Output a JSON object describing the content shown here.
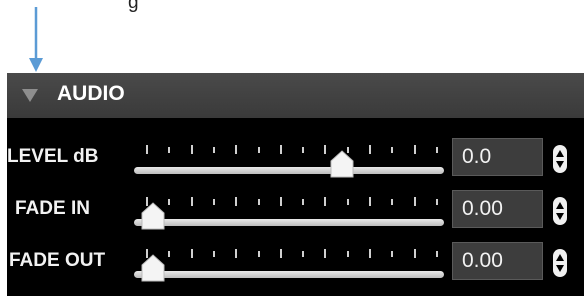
{
  "caption_fragment": "g",
  "panel": {
    "title": "AUDIO"
  },
  "rows": [
    {
      "label": "LEVEL dB",
      "value": "0.0",
      "slider_fraction": 0.68
    },
    {
      "label": "FADE IN",
      "value": "0.00",
      "slider_fraction": 0.0
    },
    {
      "label": "FADE OUT",
      "value": "0.00",
      "slider_fraction": 0.0
    }
  ],
  "icons": {
    "pointer": "down-arrow-icon",
    "collapse": "disclosure-triangle-icon",
    "stepper": "up-down-stepper-icon"
  },
  "colors": {
    "annotation_arrow": "#5b9bd5",
    "panel_bg": "#000000",
    "header_bg": "#424242"
  }
}
